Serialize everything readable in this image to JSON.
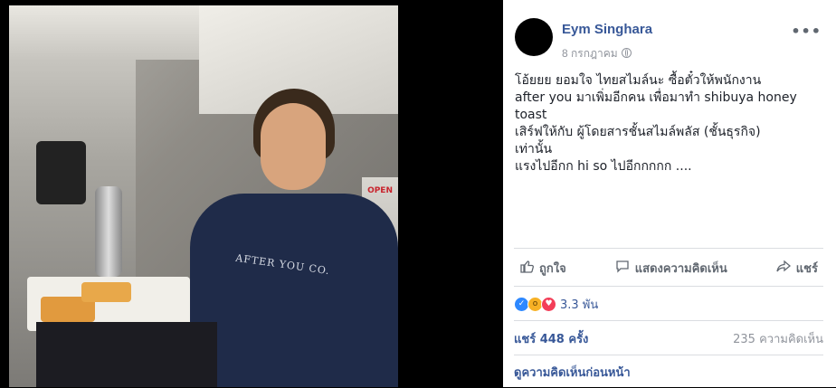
{
  "post": {
    "author": "Eym Singhara",
    "date": "8 กรกฎาคม",
    "more": "•••",
    "text": "โอ้ยยย ยอมใจ ไทยสไมล์นะ ซื้อตั๋วให้พนักงาน\nafter you มาเพิ่มอีกคน เพื่อมาทำ shibuya honey toast\nเสิร์ฟให้กับ ผู้โดยสารชั้นสไมล์พลัส (ชั้นธุรกิจ)\nเท่านั้น\nแรงไปอีกก hi so ไปอีกกกกก ....",
    "actions": {
      "like": "ถูกใจ",
      "comment": "แสดงความคิดเห็น",
      "share": "แชร์"
    },
    "reactions": {
      "count": "3.3 พัน",
      "icons": [
        "like-icon",
        "wow-icon",
        "love-icon"
      ]
    },
    "stats": {
      "shares": "แชร์ 448 ครั้ง",
      "comments": "235 ความคิดเห็น"
    },
    "previous_comments": "ดูความคิดเห็นก่อนหน้า"
  },
  "photo": {
    "shirt_text": "AFTER YOU CO.",
    "door_sign": "OPEN"
  },
  "colors": {
    "link": "#385898",
    "muted": "#90949c",
    "text": "#1d2129"
  }
}
